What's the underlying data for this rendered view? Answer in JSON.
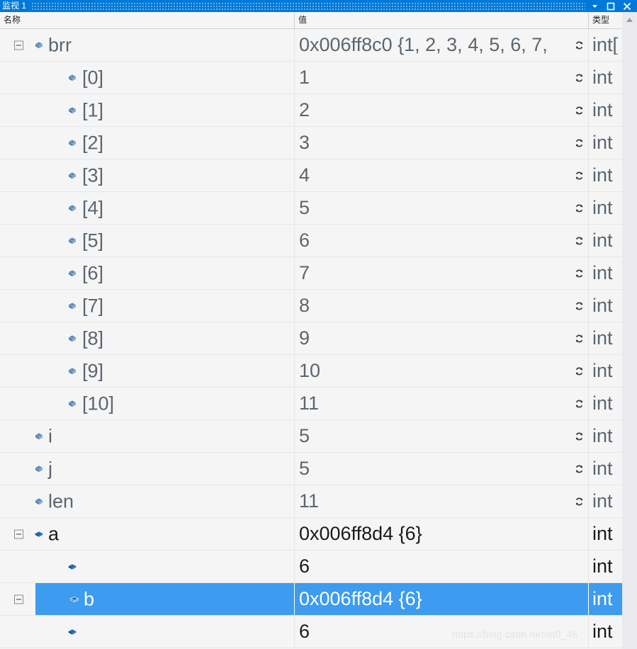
{
  "window": {
    "title": "监视 1",
    "buttons": {
      "dropdown": "▼",
      "restore": "□",
      "close": "✕"
    }
  },
  "columns": {
    "name": "名称",
    "value": "值",
    "type": "类型"
  },
  "rows": [
    {
      "level": 0,
      "expander": "expanded",
      "name": "brr",
      "value": "0x006ff8c0 {1, 2, 3, 4, 5, 6, 7,",
      "type": "int[",
      "refresh": true,
      "style": "dim",
      "selected": false
    },
    {
      "level": 1,
      "expander": "none",
      "name": "[0]",
      "value": "1",
      "type": "int",
      "refresh": true,
      "style": "dim",
      "selected": false
    },
    {
      "level": 1,
      "expander": "none",
      "name": "[1]",
      "value": "2",
      "type": "int",
      "refresh": true,
      "style": "dim",
      "selected": false
    },
    {
      "level": 1,
      "expander": "none",
      "name": "[2]",
      "value": "3",
      "type": "int",
      "refresh": true,
      "style": "dim",
      "selected": false
    },
    {
      "level": 1,
      "expander": "none",
      "name": "[3]",
      "value": "4",
      "type": "int",
      "refresh": true,
      "style": "dim",
      "selected": false
    },
    {
      "level": 1,
      "expander": "none",
      "name": "[4]",
      "value": "5",
      "type": "int",
      "refresh": true,
      "style": "dim",
      "selected": false
    },
    {
      "level": 1,
      "expander": "none",
      "name": "[5]",
      "value": "6",
      "type": "int",
      "refresh": true,
      "style": "dim",
      "selected": false
    },
    {
      "level": 1,
      "expander": "none",
      "name": "[6]",
      "value": "7",
      "type": "int",
      "refresh": true,
      "style": "dim",
      "selected": false
    },
    {
      "level": 1,
      "expander": "none",
      "name": "[7]",
      "value": "8",
      "type": "int",
      "refresh": true,
      "style": "dim",
      "selected": false
    },
    {
      "level": 1,
      "expander": "none",
      "name": "[8]",
      "value": "9",
      "type": "int",
      "refresh": true,
      "style": "dim",
      "selected": false
    },
    {
      "level": 1,
      "expander": "none",
      "name": "[9]",
      "value": "10",
      "type": "int",
      "refresh": true,
      "style": "dim",
      "selected": false
    },
    {
      "level": 1,
      "expander": "none",
      "name": "[10]",
      "value": "11",
      "type": "int",
      "refresh": true,
      "style": "dim",
      "selected": false
    },
    {
      "level": 0,
      "expander": "none",
      "name": "i",
      "value": "5",
      "type": "int",
      "refresh": true,
      "style": "dim",
      "selected": false
    },
    {
      "level": 0,
      "expander": "none",
      "name": "j",
      "value": "5",
      "type": "int",
      "refresh": true,
      "style": "dim",
      "selected": false
    },
    {
      "level": 0,
      "expander": "none",
      "name": "len",
      "value": "11",
      "type": "int",
      "refresh": true,
      "style": "dim",
      "selected": false
    },
    {
      "level": 0,
      "expander": "expanded",
      "name": "a",
      "value": "0x006ff8d4 {6}",
      "type": "int",
      "refresh": false,
      "style": "solid",
      "selected": false
    },
    {
      "level": 1,
      "expander": "none",
      "name": "",
      "value": "6",
      "type": "int",
      "refresh": false,
      "style": "solid",
      "selected": false
    },
    {
      "level": 0,
      "expander": "expanded",
      "name": "b",
      "value": "0x006ff8d4 {6}",
      "type": "int",
      "refresh": false,
      "style": "solid",
      "selected": true
    },
    {
      "level": 1,
      "expander": "none",
      "name": "",
      "value": "6",
      "type": "int",
      "refresh": false,
      "style": "solid",
      "selected": false
    }
  ],
  "watermark": "https://blog.csdn.net/m0_46",
  "colors": {
    "titlebar": "#0078d7",
    "selection": "#3d9bf0",
    "grid_background": "#f5f5f5",
    "text_dim": "#5b6670",
    "text_solid": "#1a1a1a",
    "scrollbar_track": "#e9e9ee"
  }
}
